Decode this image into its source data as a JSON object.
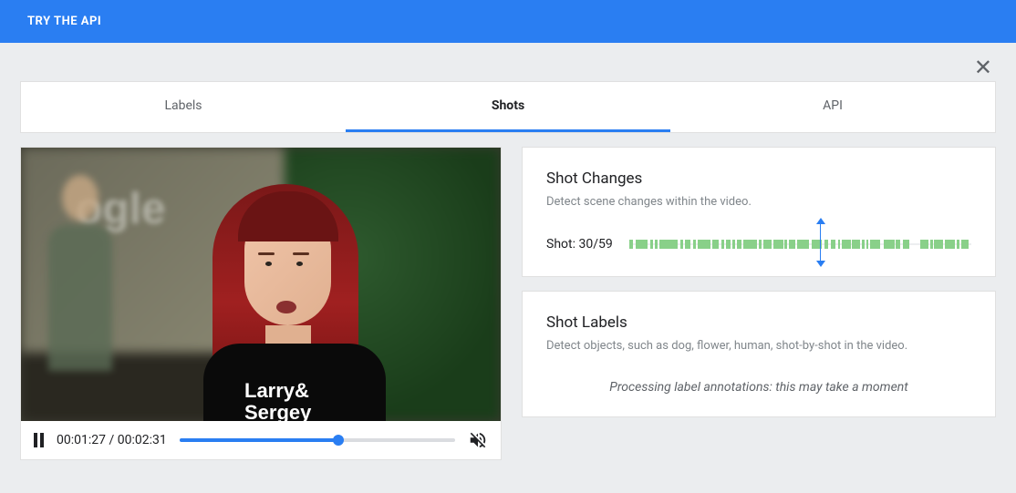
{
  "header": {
    "title": "TRY THE API"
  },
  "tabs": [
    {
      "label": "Labels",
      "active": false
    },
    {
      "label": "Shots",
      "active": true
    },
    {
      "label": "API",
      "active": false
    }
  ],
  "video": {
    "currentTime": "00:01:27",
    "duration": "00:02:31",
    "progressPercent": 57.6,
    "shirtLine1": "Larry&",
    "shirtLine2": "Sergey",
    "bgLogoHint": "ogle"
  },
  "shotChanges": {
    "title": "Shot Changes",
    "desc": "Detect scene changes within the video.",
    "shotLabel": "Shot: 30/59",
    "playheadPercent": 56,
    "segments": [
      {
        "l": 0,
        "w": 1.2
      },
      {
        "l": 2,
        "w": 3.5
      },
      {
        "l": 6.2,
        "w": 0.8
      },
      {
        "l": 7.6,
        "w": 0.8
      },
      {
        "l": 9,
        "w": 5.2
      },
      {
        "l": 15,
        "w": 0.8
      },
      {
        "l": 16.4,
        "w": 1.6
      },
      {
        "l": 18.6,
        "w": 0.8
      },
      {
        "l": 20,
        "w": 3.8
      },
      {
        "l": 24.3,
        "w": 2
      },
      {
        "l": 27,
        "w": 0.7
      },
      {
        "l": 28.2,
        "w": 1.5
      },
      {
        "l": 30.2,
        "w": 0.7
      },
      {
        "l": 31.4,
        "w": 1.5
      },
      {
        "l": 33.4,
        "w": 4
      },
      {
        "l": 38,
        "w": 0.7
      },
      {
        "l": 39.2,
        "w": 2.5
      },
      {
        "l": 42.2,
        "w": 2.8
      },
      {
        "l": 45.5,
        "w": 0.7
      },
      {
        "l": 46.7,
        "w": 2
      },
      {
        "l": 49.2,
        "w": 3.5
      },
      {
        "l": 53.3,
        "w": 3
      },
      {
        "l": 57,
        "w": 1.2
      },
      {
        "l": 59,
        "w": 1.2
      },
      {
        "l": 61,
        "w": 0.7
      },
      {
        "l": 62.2,
        "w": 2.5
      },
      {
        "l": 65.2,
        "w": 2.2
      },
      {
        "l": 68,
        "w": 0.7
      },
      {
        "l": 69.3,
        "w": 0.7
      },
      {
        "l": 70.5,
        "w": 2.8
      },
      {
        "l": 74.5,
        "w": 3
      },
      {
        "l": 78,
        "w": 1.2
      },
      {
        "l": 80,
        "w": 2
      },
      {
        "l": 85,
        "w": 2.5
      },
      {
        "l": 88,
        "w": 0.7
      },
      {
        "l": 89.2,
        "w": 2.5
      },
      {
        "l": 92.2,
        "w": 3
      },
      {
        "l": 95.8,
        "w": 0.7
      },
      {
        "l": 97,
        "w": 2.2
      }
    ]
  },
  "shotLabels": {
    "title": "Shot Labels",
    "desc": "Detect objects, such as dog, flower, human, shot-by-shot in the video.",
    "processing": "Processing label annotations: this may take a moment"
  }
}
